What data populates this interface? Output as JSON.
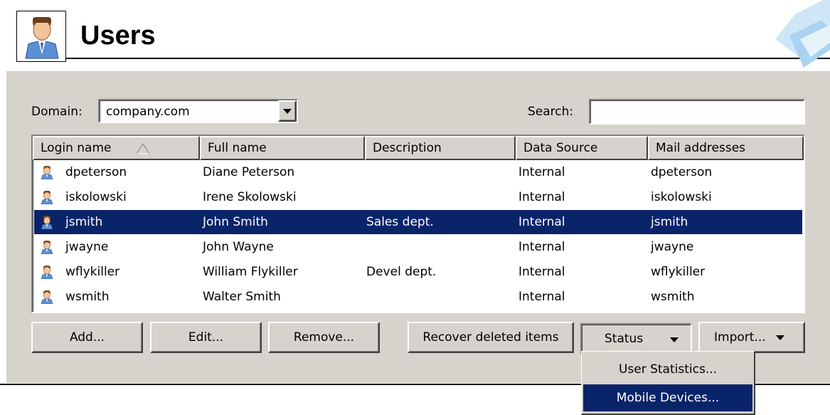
{
  "header": {
    "title": "Users"
  },
  "filters": {
    "domain_label": "Domain:",
    "domain_value": "company.com",
    "search_label": "Search:",
    "search_value": ""
  },
  "table": {
    "columns": [
      "Login name",
      "Full name",
      "Description",
      "Data Source",
      "Mail addresses"
    ],
    "sort_column": "Login name",
    "rows": [
      {
        "login": "dpeterson",
        "full_name": "Diane Peterson",
        "description": "",
        "source": "Internal",
        "mail": "dpeterson",
        "selected": false
      },
      {
        "login": "iskolowski",
        "full_name": "Irene Skolowski",
        "description": "",
        "source": "Internal",
        "mail": "iskolowski",
        "selected": false
      },
      {
        "login": "jsmith",
        "full_name": "John Smith",
        "description": "Sales dept.",
        "source": "Internal",
        "mail": "jsmith",
        "selected": true
      },
      {
        "login": "jwayne",
        "full_name": "John Wayne",
        "description": "",
        "source": "Internal",
        "mail": "jwayne",
        "selected": false
      },
      {
        "login": "wflykiller",
        "full_name": "William Flykiller",
        "description": "Devel dept.",
        "source": "Internal",
        "mail": "wflykiller",
        "selected": false
      },
      {
        "login": "wsmith",
        "full_name": "Walter Smith",
        "description": "",
        "source": "Internal",
        "mail": "wsmith",
        "selected": false
      }
    ]
  },
  "buttons": {
    "add": "Add...",
    "edit": "Edit...",
    "remove": "Remove...",
    "recover": "Recover deleted items",
    "status": "Status",
    "import": "Import..."
  },
  "status_menu": {
    "items": [
      {
        "label": "User Statistics...",
        "highlighted": false
      },
      {
        "label": "Mobile Devices...",
        "highlighted": true
      }
    ]
  },
  "colors": {
    "selection": "#0a246a",
    "panel": "#d6d2cc"
  },
  "icons": {
    "header": "user-portrait-icon",
    "row": "user-icon",
    "sort": "sort-ascending-icon"
  }
}
